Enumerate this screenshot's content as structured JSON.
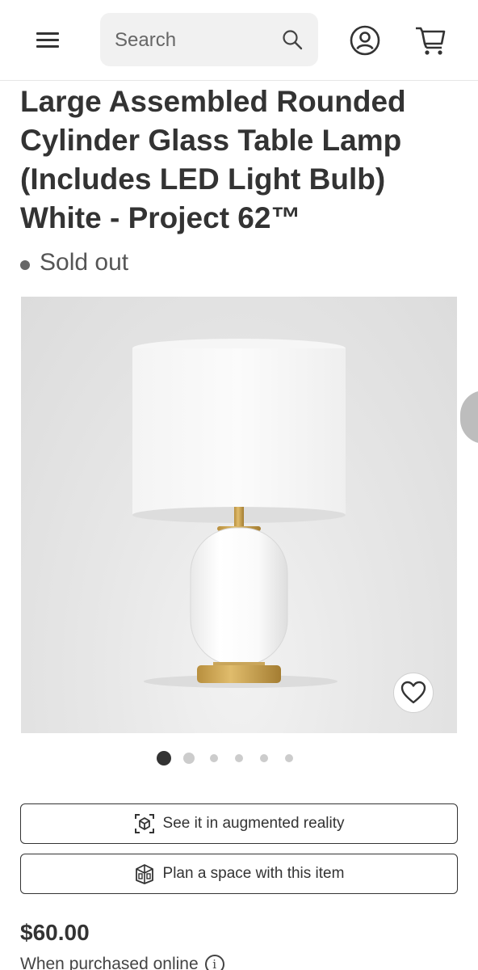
{
  "header": {
    "search": {
      "placeholder": "Search"
    },
    "icons": [
      "menu-icon",
      "search-icon",
      "account-icon",
      "cart-icon"
    ]
  },
  "product": {
    "title": "Large Assembled Rounded Cylinder Glass Table Lamp (Includes LED Light Bulb) White - Project 62™",
    "availability": "Sold out",
    "image_alt": "White rounded cylinder glass table lamp with white drum shade and brass base",
    "gallery": {
      "total_images": 6,
      "active_index": 0
    }
  },
  "actions": {
    "ar_label": "See it in augmented reality",
    "plan_label": "Plan a space with this item"
  },
  "pricing": {
    "price": "$60.00",
    "note": "When purchased online"
  },
  "colors": {
    "text": "#333333",
    "dot_active": "#333333",
    "dot_inactive": "#cccccc"
  }
}
